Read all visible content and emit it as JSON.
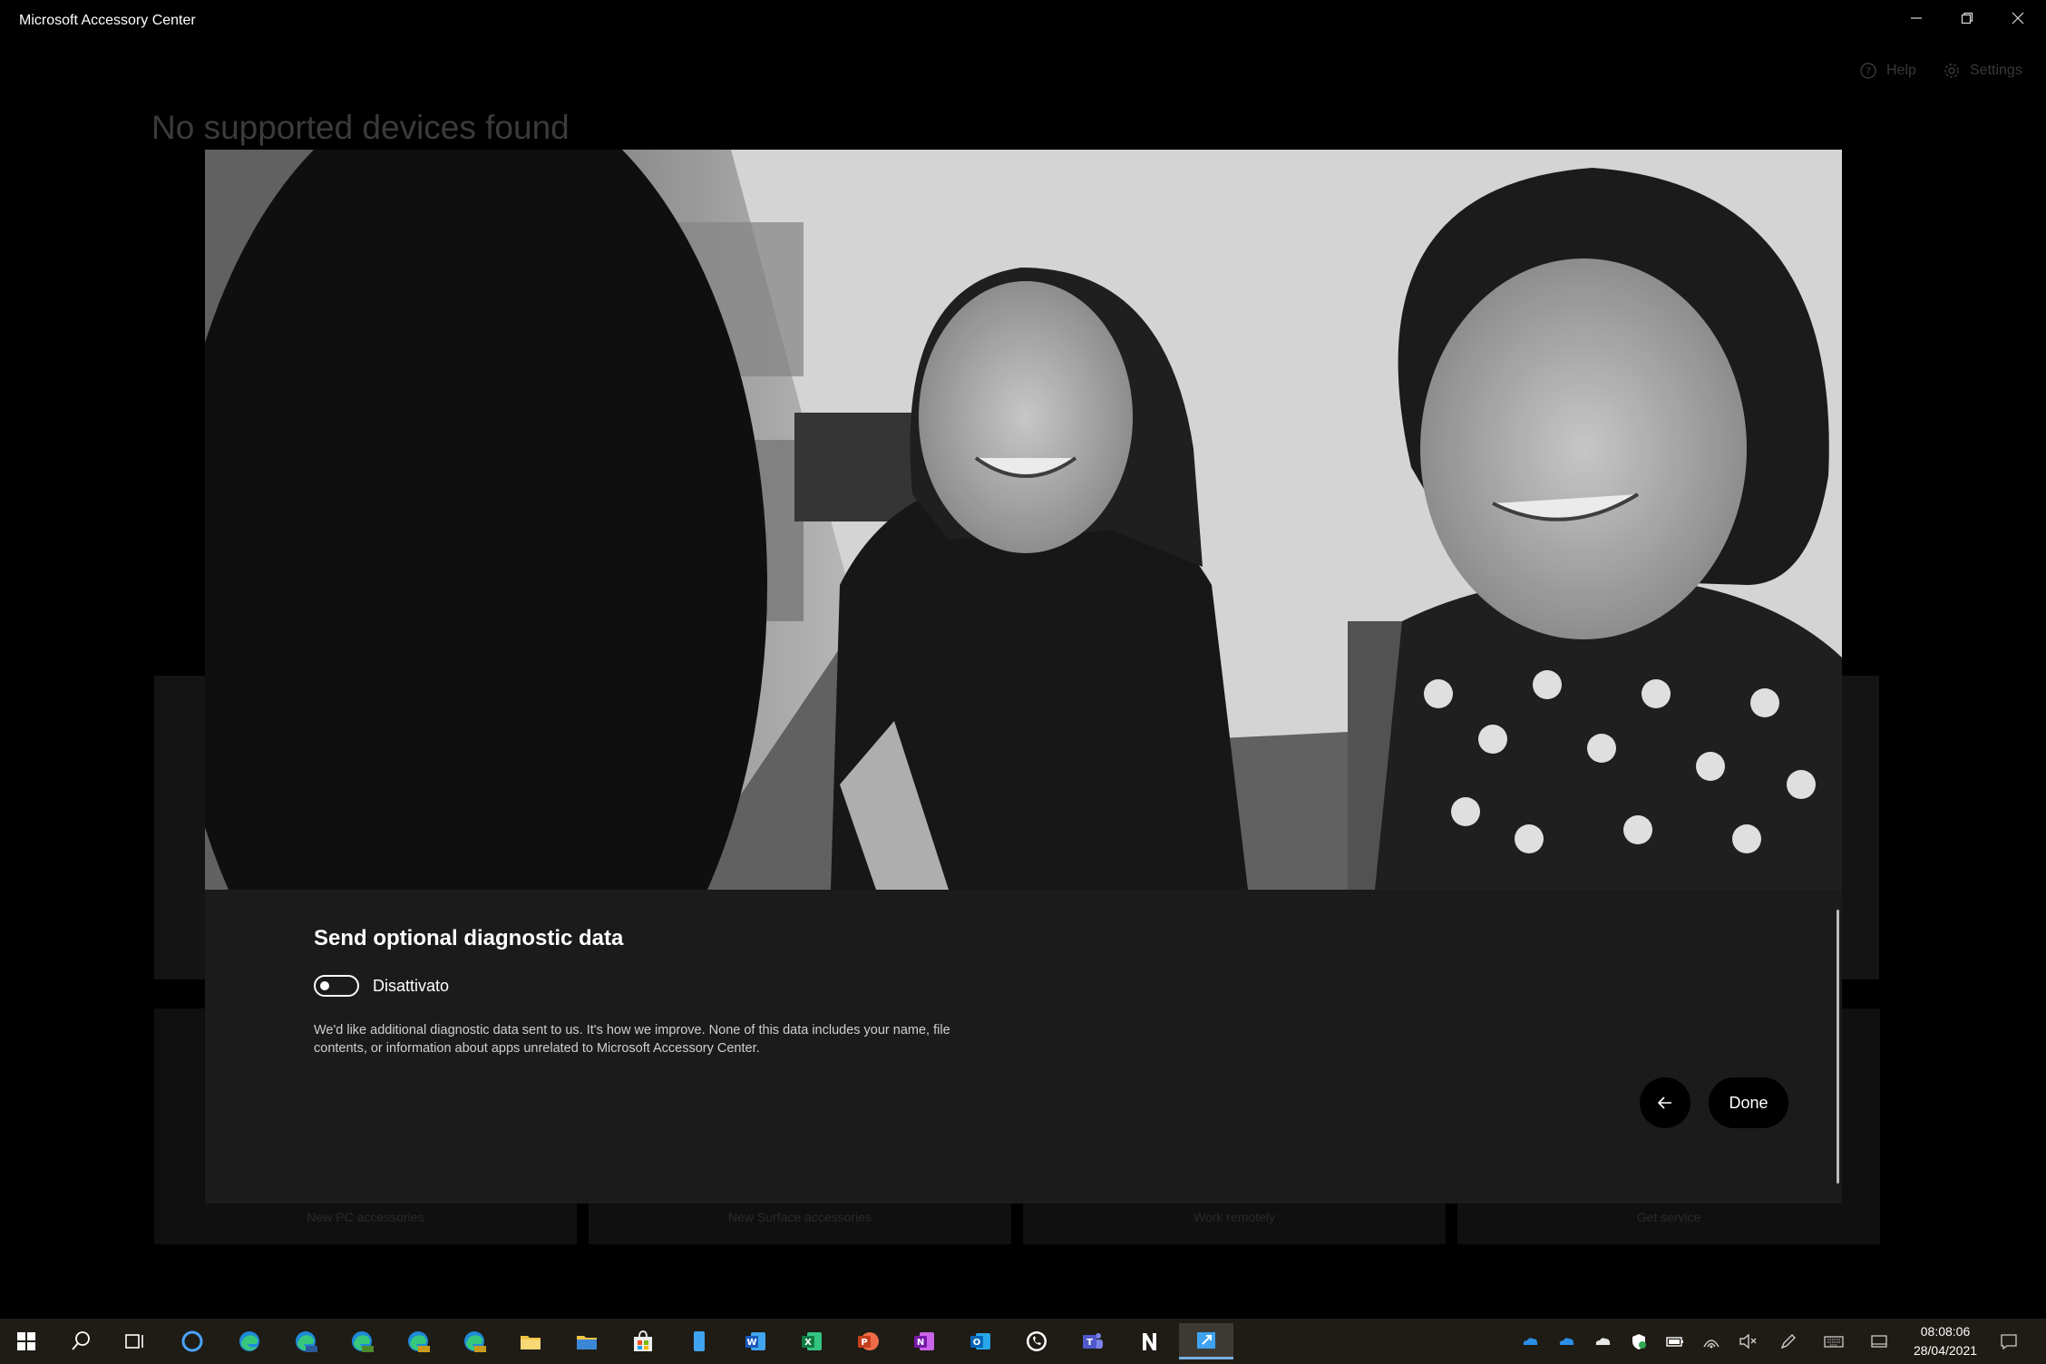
{
  "window": {
    "title": "Microsoft Accessory Center",
    "controls": {
      "minimize": "minimize-icon",
      "restore": "restore-icon",
      "close": "close-icon"
    }
  },
  "topnav": {
    "help_label": "Help",
    "settings_label": "Settings"
  },
  "background": {
    "heading": "No supported devices found",
    "tiles": [
      "New PC accessories",
      "New Surface accessories",
      "Work remotely",
      "Get service"
    ]
  },
  "dialog": {
    "title": "Send optional diagnostic data",
    "toggle": {
      "state_label": "Disattivato",
      "on": false
    },
    "description": "We'd like additional diagnostic data sent to us. It's how we improve. None of this data includes your name, file contents, or information about apps unrelated to Microsoft Accessory Center.",
    "back_icon": "arrow-left-icon",
    "done_label": "Done"
  },
  "taskbar": {
    "clock_time": "08:08:06",
    "clock_date": "28/04/2021",
    "tray_icons": [
      "onedrive-icon",
      "onedrive-icon",
      "onedrive-icon",
      "security-icon",
      "battery-icon",
      "wifi-icon",
      "volume-muted-icon",
      "pen-icon",
      "keyboard-icon",
      "tablet-icon",
      "notification-icon"
    ],
    "colors": {
      "accent": "#79aee0",
      "background": "#1f1c16"
    }
  }
}
